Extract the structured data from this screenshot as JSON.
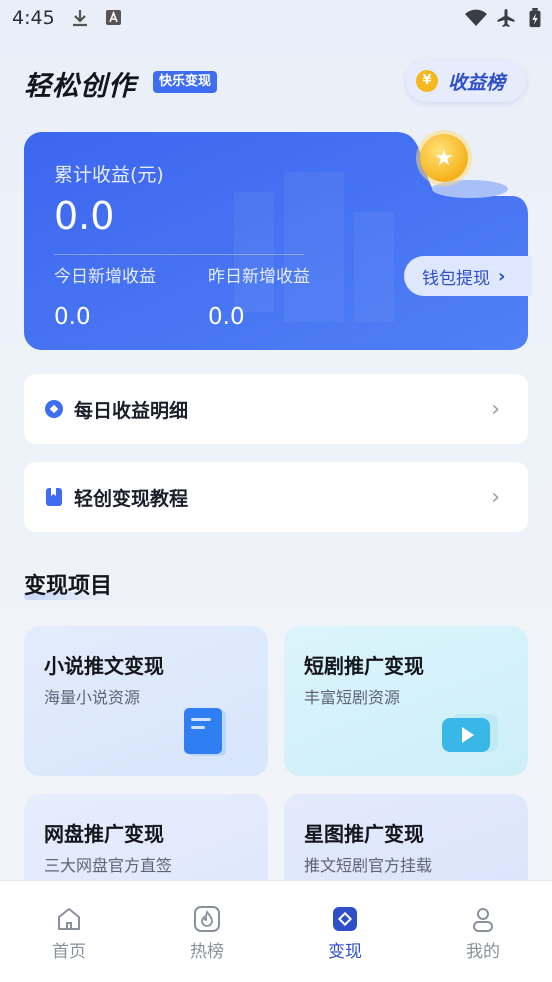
{
  "status_bar": {
    "time": "4:45"
  },
  "header": {
    "brand": "轻松创作",
    "badge": "快乐变现",
    "rank_button": "收益榜",
    "rank_coin": "¥"
  },
  "earnings": {
    "title": "累计收益(元)",
    "total": "0.0",
    "today_label": "今日新增收益",
    "today_value": "0.0",
    "yesterday_label": "昨日新增收益",
    "yesterday_value": "0.0",
    "withdraw_label": "钱包提现"
  },
  "menu": [
    {
      "label": "每日收益明细"
    },
    {
      "label": "轻创变现教程"
    }
  ],
  "section": {
    "title": "变现项目"
  },
  "projects": [
    {
      "title": "小说推文变现",
      "subtitle": "海量小说资源"
    },
    {
      "title": "短剧推广变现",
      "subtitle": "丰富短剧资源"
    },
    {
      "title": "网盘推广变现",
      "subtitle": "三大网盘官方直签"
    },
    {
      "title": "星图推广变现",
      "subtitle": "推文短剧官方挂载"
    }
  ],
  "bottom_nav": [
    {
      "label": "首页",
      "icon": "home-icon"
    },
    {
      "label": "热榜",
      "icon": "flame-icon"
    },
    {
      "label": "变现",
      "icon": "monetize-icon",
      "active": true
    },
    {
      "label": "我的",
      "icon": "profile-icon"
    }
  ],
  "colors": {
    "accent": "#2f4fc9",
    "card_blue": "#3f6df2"
  }
}
